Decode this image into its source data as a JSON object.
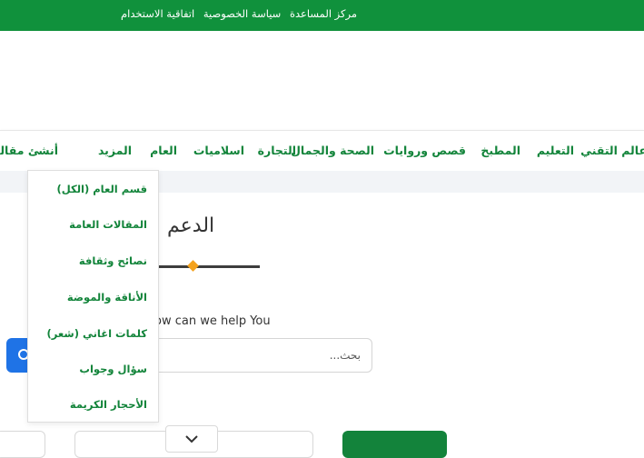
{
  "top_bar": {
    "links": [
      "مركز المساعدة",
      "سياسة الخصوصية",
      "اتفاقية الاستخدام"
    ]
  },
  "nav": {
    "items": [
      "عالم التقني",
      "التعليم",
      "المطبخ",
      "قصص وروايات",
      "الصحة والجمال",
      "التجارة",
      "اسلاميات",
      "العام",
      "المزيد",
      "أنشئ مقالة"
    ]
  },
  "dropdown": {
    "items": [
      "قسم العام (الكل)",
      "المقالات العامة",
      "نصائح وثقافة",
      "الأناقة والموضة",
      "كلمات اغاني (شعر)",
      "سؤال وجواب",
      "الأحجار الكريمة"
    ]
  },
  "support": {
    "heading": "الدعم",
    "help_text": "ow can we help You",
    "search_placeholder": "بحث..."
  },
  "colors": {
    "brand_green": "#10913c",
    "accent_orange": "#f4a21d",
    "search_blue": "#1f73e6"
  }
}
